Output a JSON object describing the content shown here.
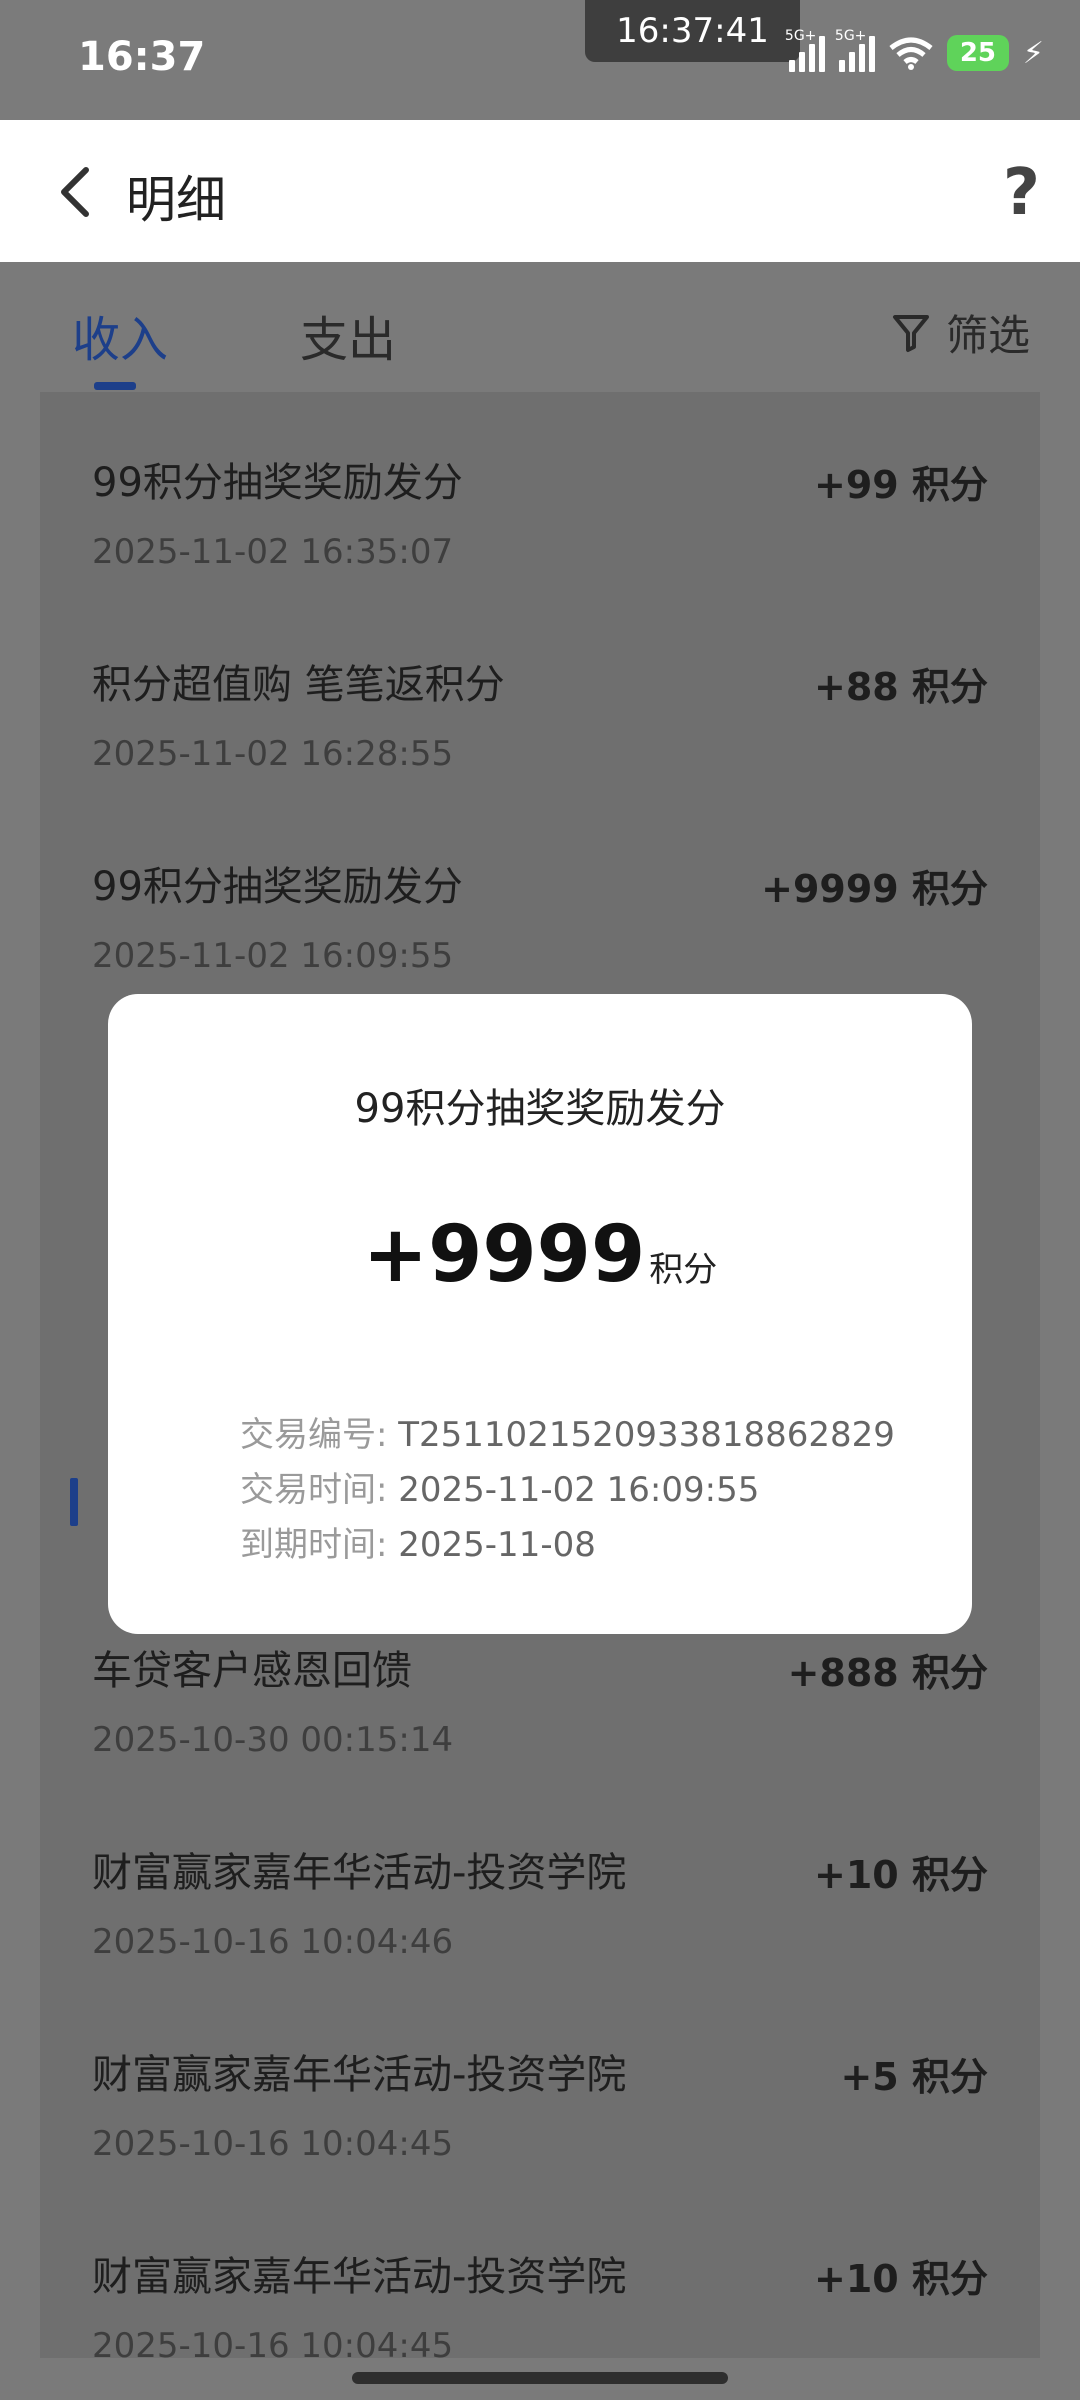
{
  "status_bar": {
    "time": "16:37",
    "center_time": "16:37:41",
    "signal1_tag": "5G+",
    "signal2_tag": "5G+",
    "battery": "25"
  },
  "nav": {
    "title": "明细",
    "help": "?"
  },
  "tabs": {
    "income": "收入",
    "expense": "支出",
    "filter": "筛选",
    "active": "income"
  },
  "list": {
    "items": [
      {
        "title": "99积分抽奖奖励发分",
        "date": "2025-11-02 16:35:07",
        "amount": "+99",
        "unit": "积分"
      },
      {
        "title": "积分超值购 笔笔返积分",
        "date": "2025-11-02 16:28:55",
        "amount": "+88",
        "unit": "积分"
      },
      {
        "title": "99积分抽奖奖励发分",
        "date": "2025-11-02 16:09:55",
        "amount": "+9999",
        "unit": "积分"
      },
      {
        "title": "",
        "date": "",
        "amount": "",
        "unit": ""
      },
      {
        "title": "",
        "date": "",
        "amount": "",
        "unit": ""
      },
      {
        "title": "车贷客户感恩回馈",
        "date": "2025-10-30 00:15:14",
        "amount": "+888",
        "unit": "积分"
      },
      {
        "title": "财富赢家嘉年华活动-投资学院",
        "date": "2025-10-16 10:04:46",
        "amount": "+10",
        "unit": "积分"
      },
      {
        "title": "财富赢家嘉年华活动-投资学院",
        "date": "2025-10-16 10:04:45",
        "amount": "+5",
        "unit": "积分"
      },
      {
        "title": "财富赢家嘉年华活动-投资学院",
        "date": "2025-10-16 10:04:45",
        "amount": "+10",
        "unit": "积分"
      }
    ]
  },
  "modal": {
    "title": "99积分抽奖奖励发分",
    "amount": "+9999",
    "unit": "积分",
    "txn_no_label": "交易编号: ",
    "txn_no": "T2511021520933818862829",
    "txn_time_label": "交易时间: ",
    "txn_time": "2025-11-02 16:09:55",
    "expire_label": "到期时间: ",
    "expire": "2025-11-08"
  },
  "colors": {
    "accent": "#1d3f8a",
    "overlay": "#7a7a7a"
  }
}
